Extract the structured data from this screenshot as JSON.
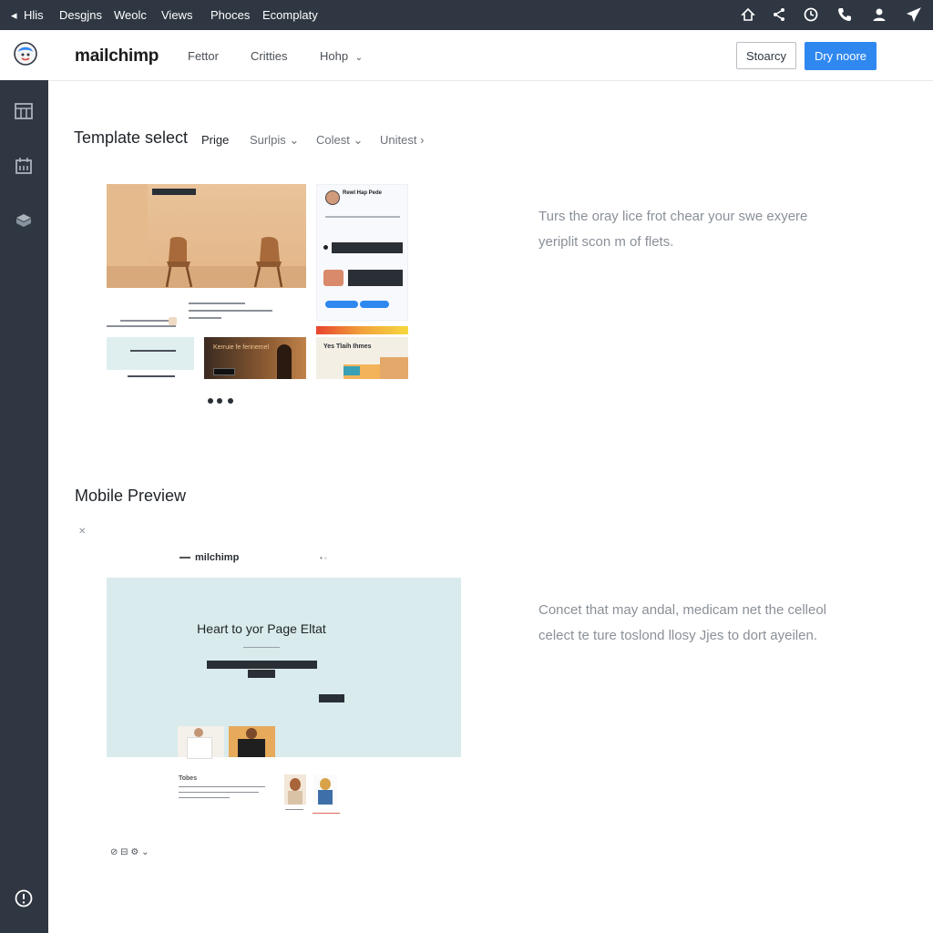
{
  "topbar": {
    "items": [
      {
        "label": "Hlis"
      },
      {
        "label": "Desgjns"
      },
      {
        "label": "Weolc"
      },
      {
        "label": "Views"
      },
      {
        "label": "Phoces"
      },
      {
        "label": "Ecomplaty"
      }
    ],
    "icons": [
      "home-icon",
      "share-icon",
      "clock-icon",
      "phone-icon",
      "user-icon",
      "plane-icon"
    ]
  },
  "header": {
    "brand": "mailchimp",
    "nav": [
      {
        "label": "Fettor"
      },
      {
        "label": "Critties"
      },
      {
        "label": "Hohp"
      }
    ],
    "secondary_button": "Stoarcy",
    "primary_button": "Dry noore"
  },
  "sidebar": {
    "icons": [
      "grid-icon",
      "calendar-icon",
      "cube-icon",
      "help-circle-icon"
    ]
  },
  "template_select": {
    "title": "Template select",
    "tabs": [
      {
        "label": "Prige"
      },
      {
        "label": "Surlpis"
      },
      {
        "label": "Colest"
      },
      {
        "label": "Unitest"
      }
    ],
    "description_line1": "Turs the oray lice frot chear your swe exyere",
    "description_line2": "yeriplit scon m of flets.",
    "right_card_title": "Rewl Hap Pede",
    "dark_card_text": "Kerruie fe ferinemel",
    "colorful_card_text": "Yes Tlaih Ihmes"
  },
  "mobile_preview": {
    "title": "Mobile Preview",
    "brand": "milchimp",
    "headline": "Heart to yor Page Eltat",
    "description_line1": "Concet that may andal, medicam net the celleol",
    "description_line2": "celect te ture toslond llosy Jjes to dort ayeilen.",
    "footer_label": "Tobes"
  },
  "colors": {
    "dark": "#2e3742",
    "primary": "#2f88f0",
    "preview_bg": "#d9ebec"
  }
}
